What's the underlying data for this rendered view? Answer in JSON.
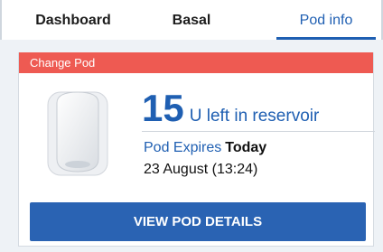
{
  "tabs": [
    {
      "label": "Dashboard",
      "active": false
    },
    {
      "label": "Basal",
      "active": false
    },
    {
      "label": "Pod info",
      "active": true
    }
  ],
  "alert": {
    "label": "Change Pod",
    "color": "#ee5a52"
  },
  "reservoir": {
    "units": "15",
    "label": "U left in reservoir"
  },
  "expiry": {
    "label": "Pod Expires",
    "value": "Today",
    "date": "23 August (13:24)"
  },
  "button": {
    "label": "VIEW POD DETAILS"
  },
  "pod_image": {
    "icon": "omnipod-icon"
  },
  "colors": {
    "accent": "#1f5fb2",
    "button": "#2a63b3",
    "alert": "#ee5a52"
  }
}
